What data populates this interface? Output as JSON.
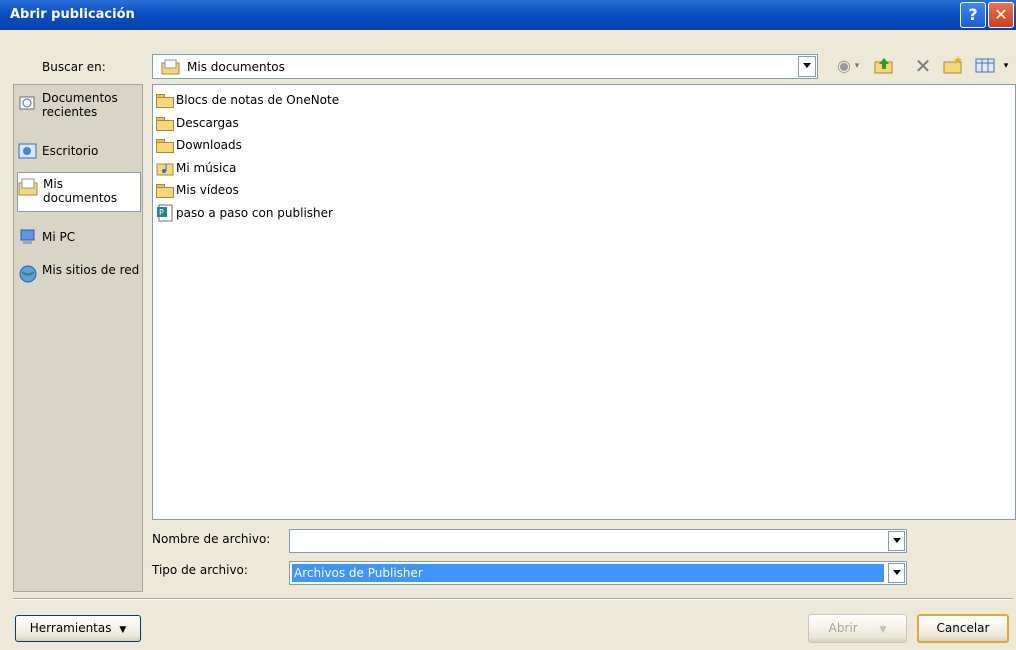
{
  "window": {
    "title": "Abrir publicación",
    "help_label": "?",
    "close_label": "✕"
  },
  "lookin": {
    "label": "Buscar en:",
    "value": "Mis documentos"
  },
  "places": [
    {
      "label": "Documentos recientes",
      "icon": "recent-documents-icon"
    },
    {
      "label": "Escritorio",
      "icon": "desktop-icon"
    },
    {
      "label": "Mis documentos",
      "icon": "my-documents-icon",
      "selected": true
    },
    {
      "label": "Mi PC",
      "icon": "my-computer-icon"
    },
    {
      "label": "Mis sitios de red",
      "icon": "network-icon"
    }
  ],
  "files": [
    {
      "name": "Blocs de notas de OneNote",
      "icon": "folder-icon"
    },
    {
      "name": "Descargas",
      "icon": "folder-icon"
    },
    {
      "name": "Downloads",
      "icon": "folder-icon"
    },
    {
      "name": "Mi música",
      "icon": "music-folder-icon"
    },
    {
      "name": "Mis vídeos",
      "icon": "folder-icon"
    },
    {
      "name": "paso a paso con publisher",
      "icon": "publisher-file-icon"
    }
  ],
  "filename": {
    "label": "Nombre de archivo:",
    "value": ""
  },
  "filetype": {
    "label": "Tipo de archivo:",
    "value": "Archivos de Publisher"
  },
  "buttons": {
    "tools": "Herramientas",
    "open": "Abrir",
    "cancel": "Cancelar"
  },
  "colors": {
    "titlebar": "#0a4fc2",
    "selection": "#3d95ff"
  }
}
